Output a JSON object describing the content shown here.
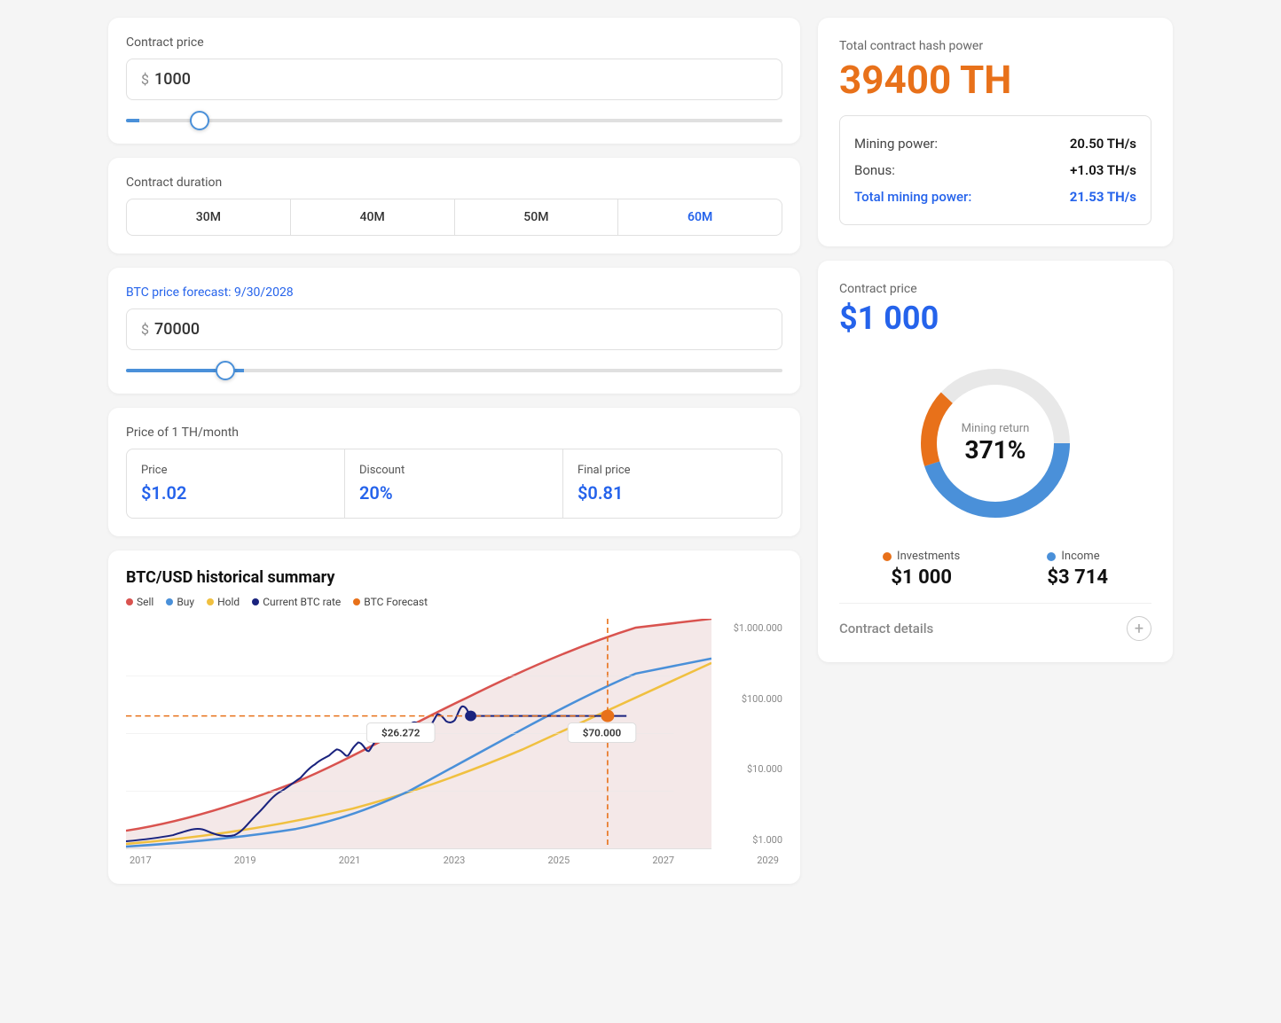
{
  "left": {
    "contract_price_label": "Contract price",
    "contract_price_amount": "1000",
    "contract_price_currency": "$",
    "contract_duration_label": "Contract duration",
    "duration_tabs": [
      "30M",
      "40M",
      "50M",
      "60M"
    ],
    "active_tab_index": 3,
    "btc_forecast_label": "BTC price forecast:",
    "btc_forecast_date": "9/30/2028",
    "btc_forecast_amount": "70000",
    "btc_forecast_currency": "$",
    "price_th_label": "Price of 1 TH/month",
    "price_cell_label": "Price",
    "price_cell_value": "$1.02",
    "discount_cell_label": "Discount",
    "discount_cell_value": "20%",
    "final_price_cell_label": "Final price",
    "final_price_cell_value": "$0.81",
    "chart_title": "BTC/USD historical summary",
    "legend": [
      {
        "label": "Sell",
        "color": "#d9534f"
      },
      {
        "label": "Buy",
        "color": "#4a90d9"
      },
      {
        "label": "Hold",
        "color": "#f0c040"
      },
      {
        "label": "Current BTC rate",
        "color": "#1a237e"
      },
      {
        "label": "BTC Forecast",
        "color": "#e8711a"
      }
    ],
    "x_labels": [
      "2017",
      "2019",
      "2021",
      "2023",
      "2025",
      "2027",
      "2029"
    ],
    "y_labels": [
      "$1.000.000",
      "$100.000",
      "$10.000",
      "$1.000"
    ],
    "tooltip1_value": "$26.272",
    "tooltip2_value": "$70.000"
  },
  "right": {
    "hash_power_label": "Total contract hash power",
    "hash_power_value": "39400 TH",
    "mining_power_label": "Mining power:",
    "mining_power_value": "20.50 TH/s",
    "bonus_label": "Bonus:",
    "bonus_value": "+1.03 TH/s",
    "total_mining_label": "Total mining power:",
    "total_mining_value": "21.53 TH/s",
    "contract_price_label": "Contract price",
    "contract_price_value": "$1 000",
    "donut_center_label": "Mining return",
    "donut_center_value": "371%",
    "investments_label": "Investments",
    "investments_value": "$1 000",
    "income_label": "Income",
    "income_value": "$3 714",
    "contract_details_label": "Contract details"
  }
}
